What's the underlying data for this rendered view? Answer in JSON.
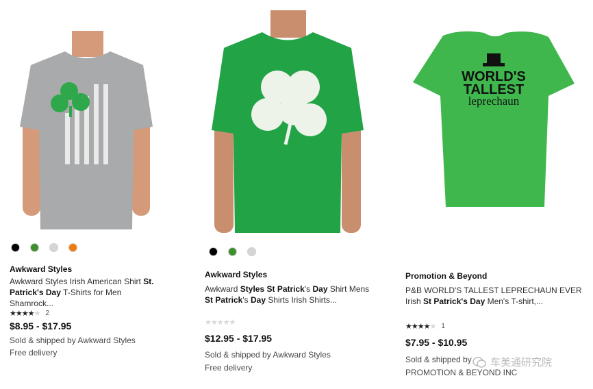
{
  "products": [
    {
      "brand": "Awkward Styles",
      "title_parts": [
        "Awkward Styles Irish American Shirt ",
        "St.",
        " ",
        "Patrick's Day",
        " T-Shirts for Men Shamrock..."
      ],
      "title_bold": [
        false,
        true,
        false,
        true,
        false
      ],
      "rating_stars": 3.5,
      "rating_count": "2",
      "price": "$8.95 - $17.95",
      "seller": "Sold & shipped by Awkward Styles",
      "delivery": "Free delivery",
      "swatches": [
        "#000000",
        "#3e8f2e",
        "#d5d5d5",
        "#f07c0f"
      ],
      "shirt_color": "#a9aaab",
      "graphic": "flag-shamrock"
    },
    {
      "brand": "Awkward Styles",
      "title_parts": [
        "Awkward ",
        "Styles",
        " ",
        "St Patrick",
        "'s ",
        "Day",
        " Shirt Mens ",
        "St Patrick",
        "'s ",
        "Day",
        " Shirts Irish Shirts..."
      ],
      "title_bold": [
        false,
        true,
        false,
        true,
        false,
        true,
        false,
        true,
        false,
        true,
        false
      ],
      "rating_stars": 0,
      "rating_count": "",
      "price": "$12.95 - $17.95",
      "seller": "Sold & shipped by Awkward Styles",
      "delivery": "Free delivery",
      "swatches": [
        "#000000",
        "#3e8f2e",
        "#d5d5d5"
      ],
      "shirt_color": "#21a346",
      "graphic": "white-shamrock"
    },
    {
      "brand": "Promotion & Beyond",
      "title_parts": [
        "P&B WORLD'S TALLEST LEPRECHAUN EVER Irish ",
        "St Patrick's Day",
        " Men's T-shirt,..."
      ],
      "title_bold": [
        false,
        true,
        false
      ],
      "rating_stars": 4,
      "rating_count": "1",
      "price": "$7.95 - $10.95",
      "seller": "Sold & shipped by",
      "seller_line2": "PROMOTION & BEYOND INC",
      "shirt_color": "#3fb74d",
      "shirt_text": [
        "WORLD'S",
        "TALLEST",
        "leprechaun"
      ]
    }
  ],
  "watermark": "车美通研究院"
}
